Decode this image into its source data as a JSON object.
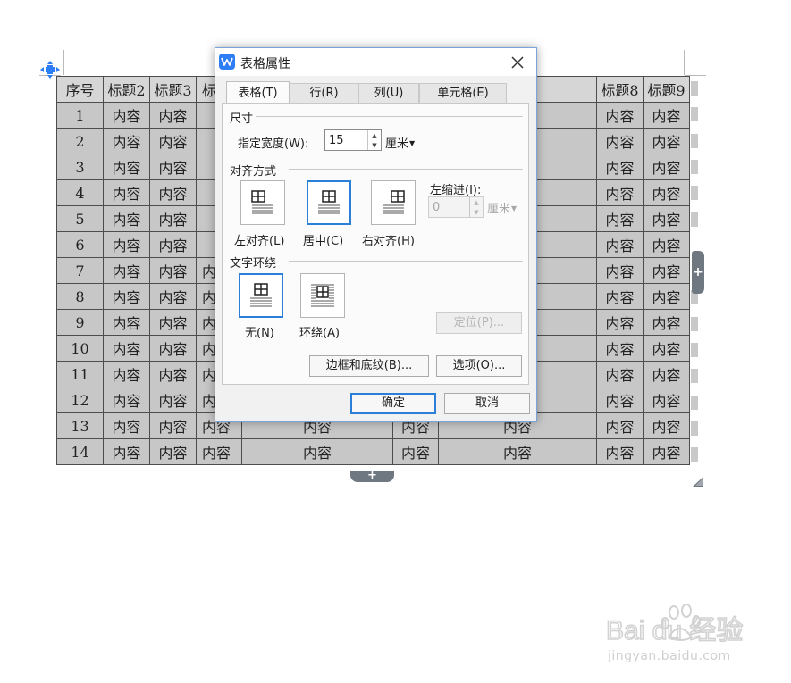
{
  "table": {
    "header": [
      "序号",
      "标题2",
      "标题3",
      "标",
      "",
      "",
      "",
      "标题8",
      "标题9"
    ],
    "rows": [
      [
        "1",
        "内容",
        "内容",
        "",
        "",
        "",
        "",
        "内容",
        "内容"
      ],
      [
        "2",
        "内容",
        "内容",
        "",
        "",
        "",
        "",
        "内容",
        "内容"
      ],
      [
        "3",
        "内容",
        "内容",
        "",
        "",
        "",
        "",
        "内容",
        "内容"
      ],
      [
        "4",
        "内容",
        "内容",
        "",
        "",
        "",
        "",
        "内容",
        "内容"
      ],
      [
        "5",
        "内容",
        "内容",
        "",
        "",
        "",
        "",
        "内容",
        "内容"
      ],
      [
        "6",
        "内容",
        "内容",
        "",
        "",
        "",
        "",
        "内容",
        "内容"
      ],
      [
        "7",
        "内容",
        "内容",
        "内",
        "",
        "",
        "",
        "内容",
        "内容"
      ],
      [
        "8",
        "内容",
        "内容",
        "内",
        "",
        "",
        "",
        "内容",
        "内容"
      ],
      [
        "9",
        "内容",
        "内容",
        "内",
        "",
        "",
        "",
        "内容",
        "内容"
      ],
      [
        "10",
        "内容",
        "内容",
        "内",
        "",
        "",
        "",
        "内容",
        "内容"
      ],
      [
        "11",
        "内容",
        "内容",
        "内",
        "",
        "",
        "",
        "内容",
        "内容"
      ],
      [
        "12",
        "内容",
        "内容",
        "内",
        "",
        "",
        "",
        "内容",
        "内容"
      ],
      [
        "13",
        "内容",
        "内容",
        "内容",
        "内容",
        "内容",
        "内容",
        "内容",
        "内容"
      ],
      [
        "14",
        "内容",
        "内容",
        "内容",
        "内容",
        "内容",
        "内容",
        "内容",
        "内容"
      ]
    ],
    "add_col_symbol": "+",
    "add_row_symbol": "+"
  },
  "dialog": {
    "title": "表格属性",
    "close_symbol": "✕",
    "tabs": [
      "表格(T)",
      "行(R)",
      "列(U)",
      "单元格(E)"
    ],
    "active_tab": "表格(T)",
    "size_section": "尺寸",
    "width_label": "指定宽度(W):",
    "width_value": "15",
    "width_unit": "厘米",
    "align_section": "对齐方式",
    "align_left": "左对齐(L)",
    "align_center": "居中(C)",
    "align_right": "右对齐(H)",
    "selected_alignment": "居中(C)",
    "indent_label": "左缩进(I):",
    "indent_value": "0",
    "indent_unit": "厘米",
    "wrap_section": "文字环绕",
    "wrap_none": "无(N)",
    "wrap_around": "环绕(A)",
    "selected_wrap": "无(N)",
    "position_button": "定位(P)...",
    "borders_button": "边框和底纹(B)...",
    "options_button": "选项(O)...",
    "ok_button": "确定",
    "cancel_button": "取消"
  },
  "watermark": {
    "brand": "Bai du 经验",
    "url": "jingyan.baidu.com"
  },
  "colors": {
    "accent": "#2b7fd6",
    "table_fill": "#c7c7c7",
    "app_icon": "#2d7df6"
  }
}
